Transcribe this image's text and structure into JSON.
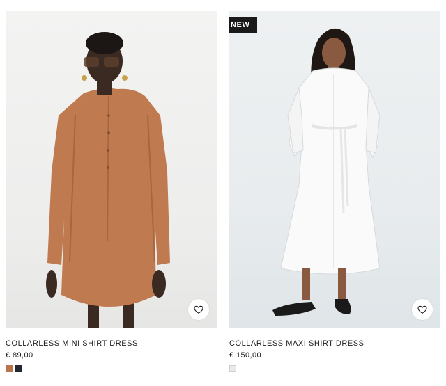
{
  "products": [
    {
      "badge": "",
      "name": "COLLARLESS MINI SHIRT DRESS",
      "price": "€ 89,00",
      "image_icon": "product-photo-mini-shirt-dress",
      "wishlist_icon": "heart-outline-icon",
      "swatches": [
        {
          "color": "#b8744c",
          "name": "tan"
        },
        {
          "color": "#232733",
          "name": "navy"
        }
      ]
    },
    {
      "badge": "NEW",
      "name": "COLLARLESS MAXI SHIRT DRESS",
      "price": "€ 150,00",
      "image_icon": "product-photo-maxi-shirt-dress",
      "wishlist_icon": "heart-outline-icon",
      "swatches": [
        {
          "color": "#e9e9e9",
          "name": "white"
        }
      ]
    }
  ],
  "colors": {
    "badge_bg": "#1a1a1a",
    "text": "#1a1a1a"
  }
}
